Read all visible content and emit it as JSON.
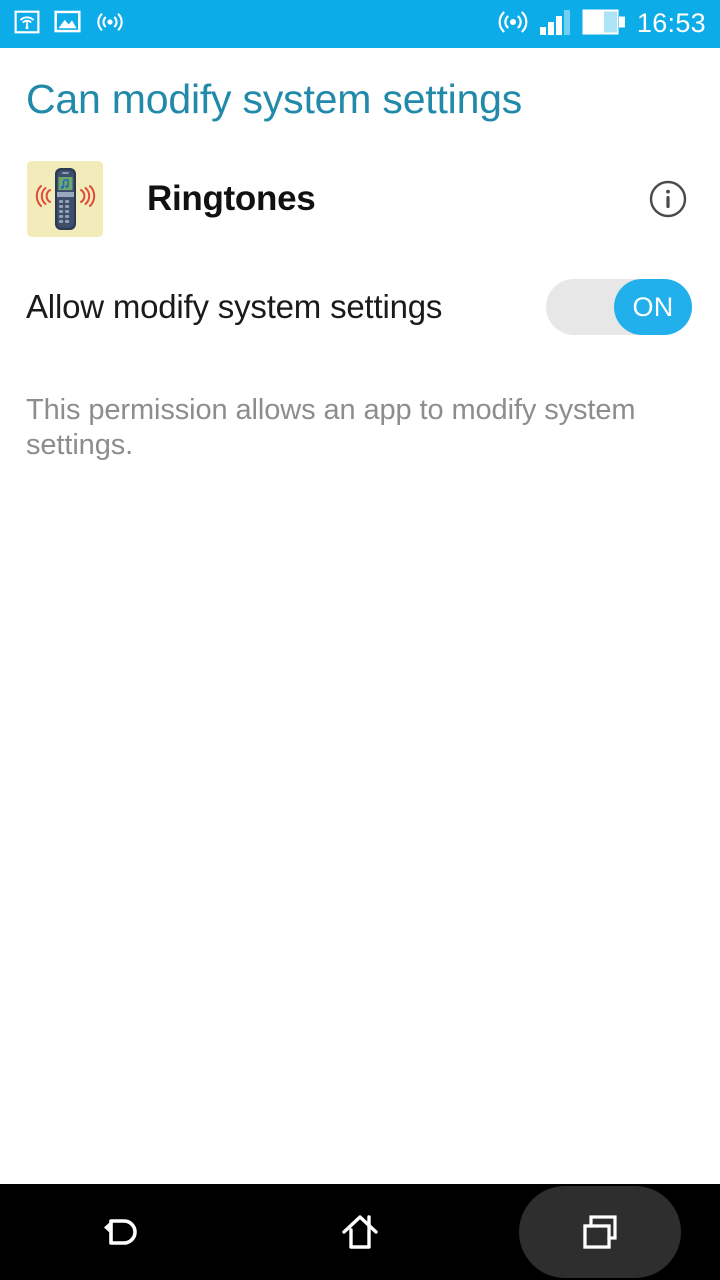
{
  "status_bar": {
    "background_color": "#0cace9",
    "time": "16:53",
    "left_icons": [
      "cast-screen-icon",
      "screenshot-image-icon",
      "wireless-broadcast-icon"
    ],
    "right_icons": [
      "hotspot-icon",
      "cellular-signal-icon",
      "battery-icon"
    ],
    "signal_bars_filled": 3,
    "signal_bars_total": 4,
    "battery_level_percent": 60
  },
  "header": {
    "title": "Can modify system settings",
    "title_color": "#2189a9"
  },
  "app": {
    "name": "Ringtones",
    "icon_name": "ringtones-app-icon",
    "icon_background_color": "#f2ecbb",
    "info_button_label": "i"
  },
  "permission_toggle": {
    "label": "Allow modify system settings",
    "state_label": "ON",
    "is_on": true,
    "track_color": "#e7e7e7",
    "thumb_color": "#22b0ec"
  },
  "description": {
    "text": "This permission allows an app to modify system settings.",
    "color": "#8d8d8d"
  },
  "navigation_bar": {
    "background_color": "#000000",
    "buttons": [
      {
        "name": "back",
        "icon": "back-arrow-icon",
        "highlighted": false
      },
      {
        "name": "home",
        "icon": "home-icon",
        "highlighted": false
      },
      {
        "name": "recents",
        "icon": "recents-icon",
        "highlighted": true
      }
    ],
    "highlight_color": "#2e2e2e"
  }
}
